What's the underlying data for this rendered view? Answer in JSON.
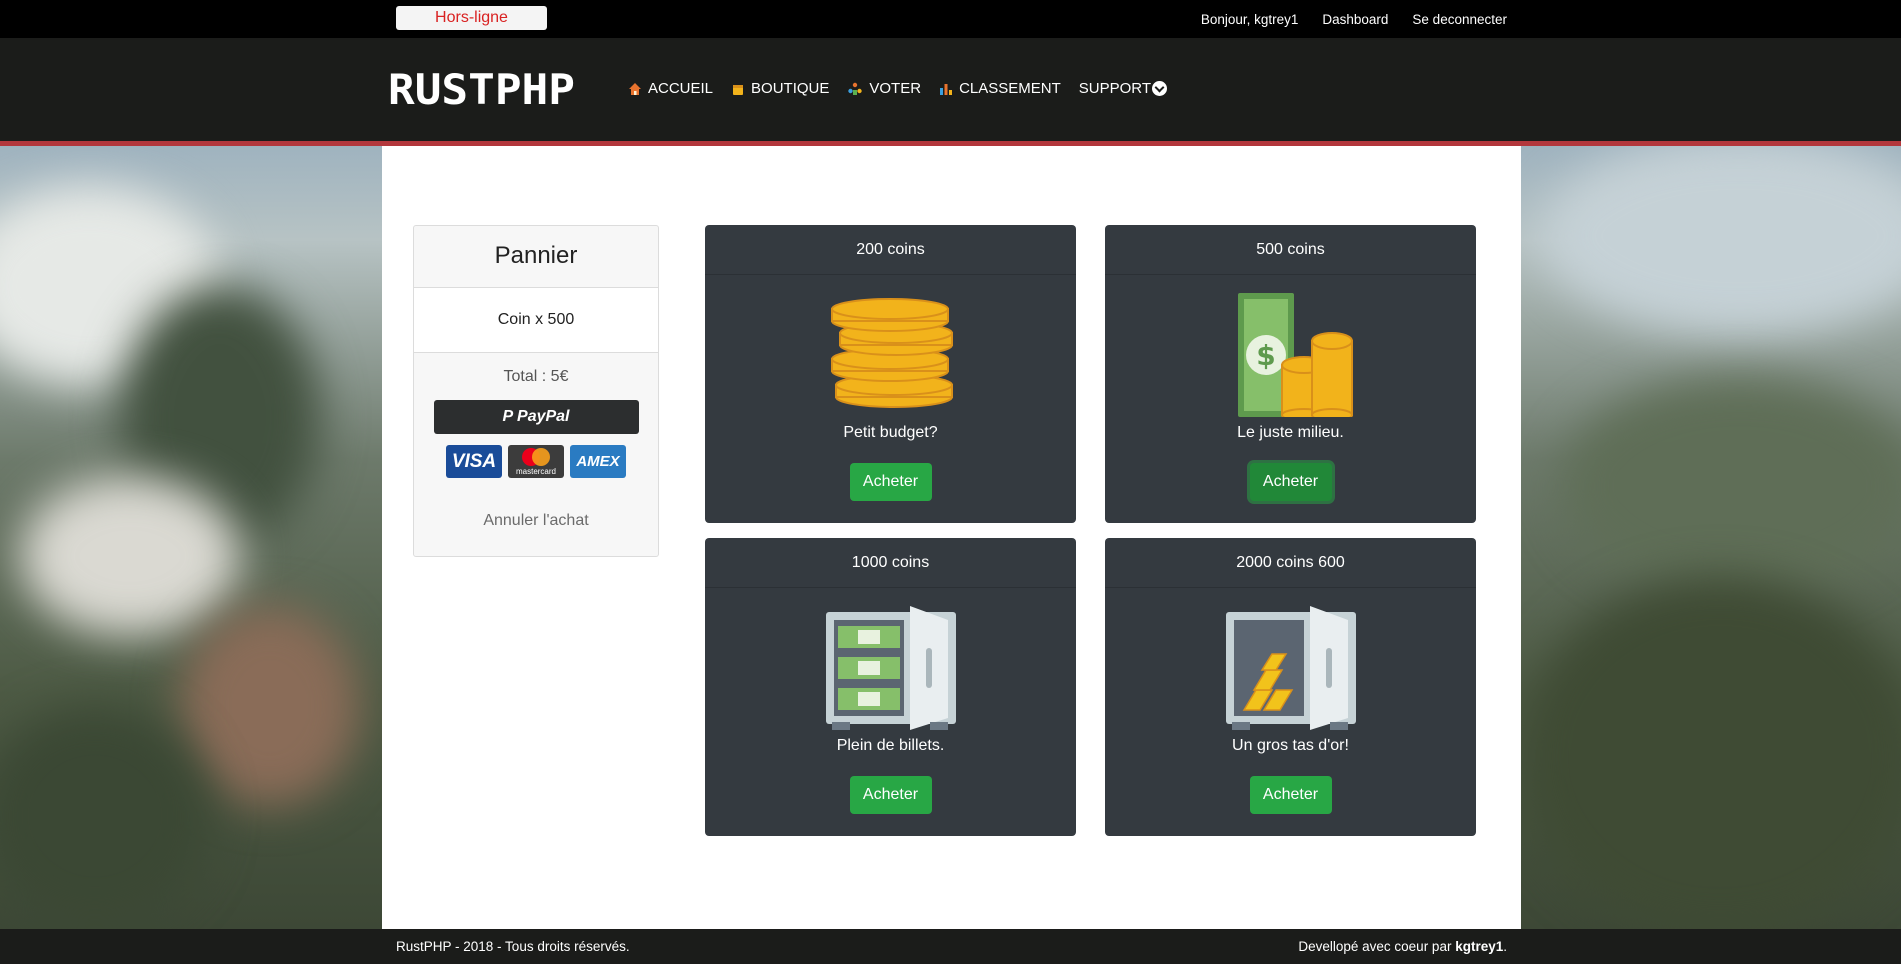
{
  "topbar": {
    "status": "Hors-ligne",
    "greeting": "Bonjour, kgtrey1",
    "dashboard": "Dashboard",
    "logout": "Se deconnecter"
  },
  "header": {
    "logo_text": "RUSTPHP",
    "nav": [
      {
        "label": "ACCUEIL",
        "icon": "home-icon"
      },
      {
        "label": "BOUTIQUE",
        "icon": "shop-icon"
      },
      {
        "label": "VOTER",
        "icon": "vote-icon"
      },
      {
        "label": "CLASSEMENT",
        "icon": "ranking-icon"
      },
      {
        "label": "SUPPORT",
        "icon": "chevron-down-icon"
      }
    ]
  },
  "cart": {
    "title": "Pannier",
    "item": "Coin x 500",
    "total": "Total : 5€",
    "paypal_label": "PayPal",
    "cards": [
      "VISA",
      "mastercard",
      "AMEX"
    ],
    "cancel": "Annuler l'achat"
  },
  "offers": [
    {
      "title": "200 coins",
      "caption": "Petit budget?",
      "button": "Acheter",
      "icon": "coin-stack-icon"
    },
    {
      "title": "500 coins",
      "caption": "Le juste milieu.",
      "button": "Acheter",
      "icon": "money-coins-icon"
    },
    {
      "title": "1000 coins",
      "caption": "Plein de billets.",
      "button": "Acheter",
      "icon": "safe-bills-icon"
    },
    {
      "title": "2000 coins 600",
      "caption": "Un gros tas d'or!",
      "button": "Acheter",
      "icon": "safe-gold-icon"
    }
  ],
  "footer": {
    "left": "RustPHP - 2018 - Tous droits réservés.",
    "right_prefix": "Devellopé avec coeur par ",
    "right_author": "kgtrey1",
    "right_suffix": "."
  },
  "colors": {
    "topbar": "#000000",
    "header": "#1b1c1a",
    "accent_line": "#b3373c",
    "card_bg": "#343a40",
    "buy_button": "#28a745",
    "status_text": "#d92121"
  }
}
